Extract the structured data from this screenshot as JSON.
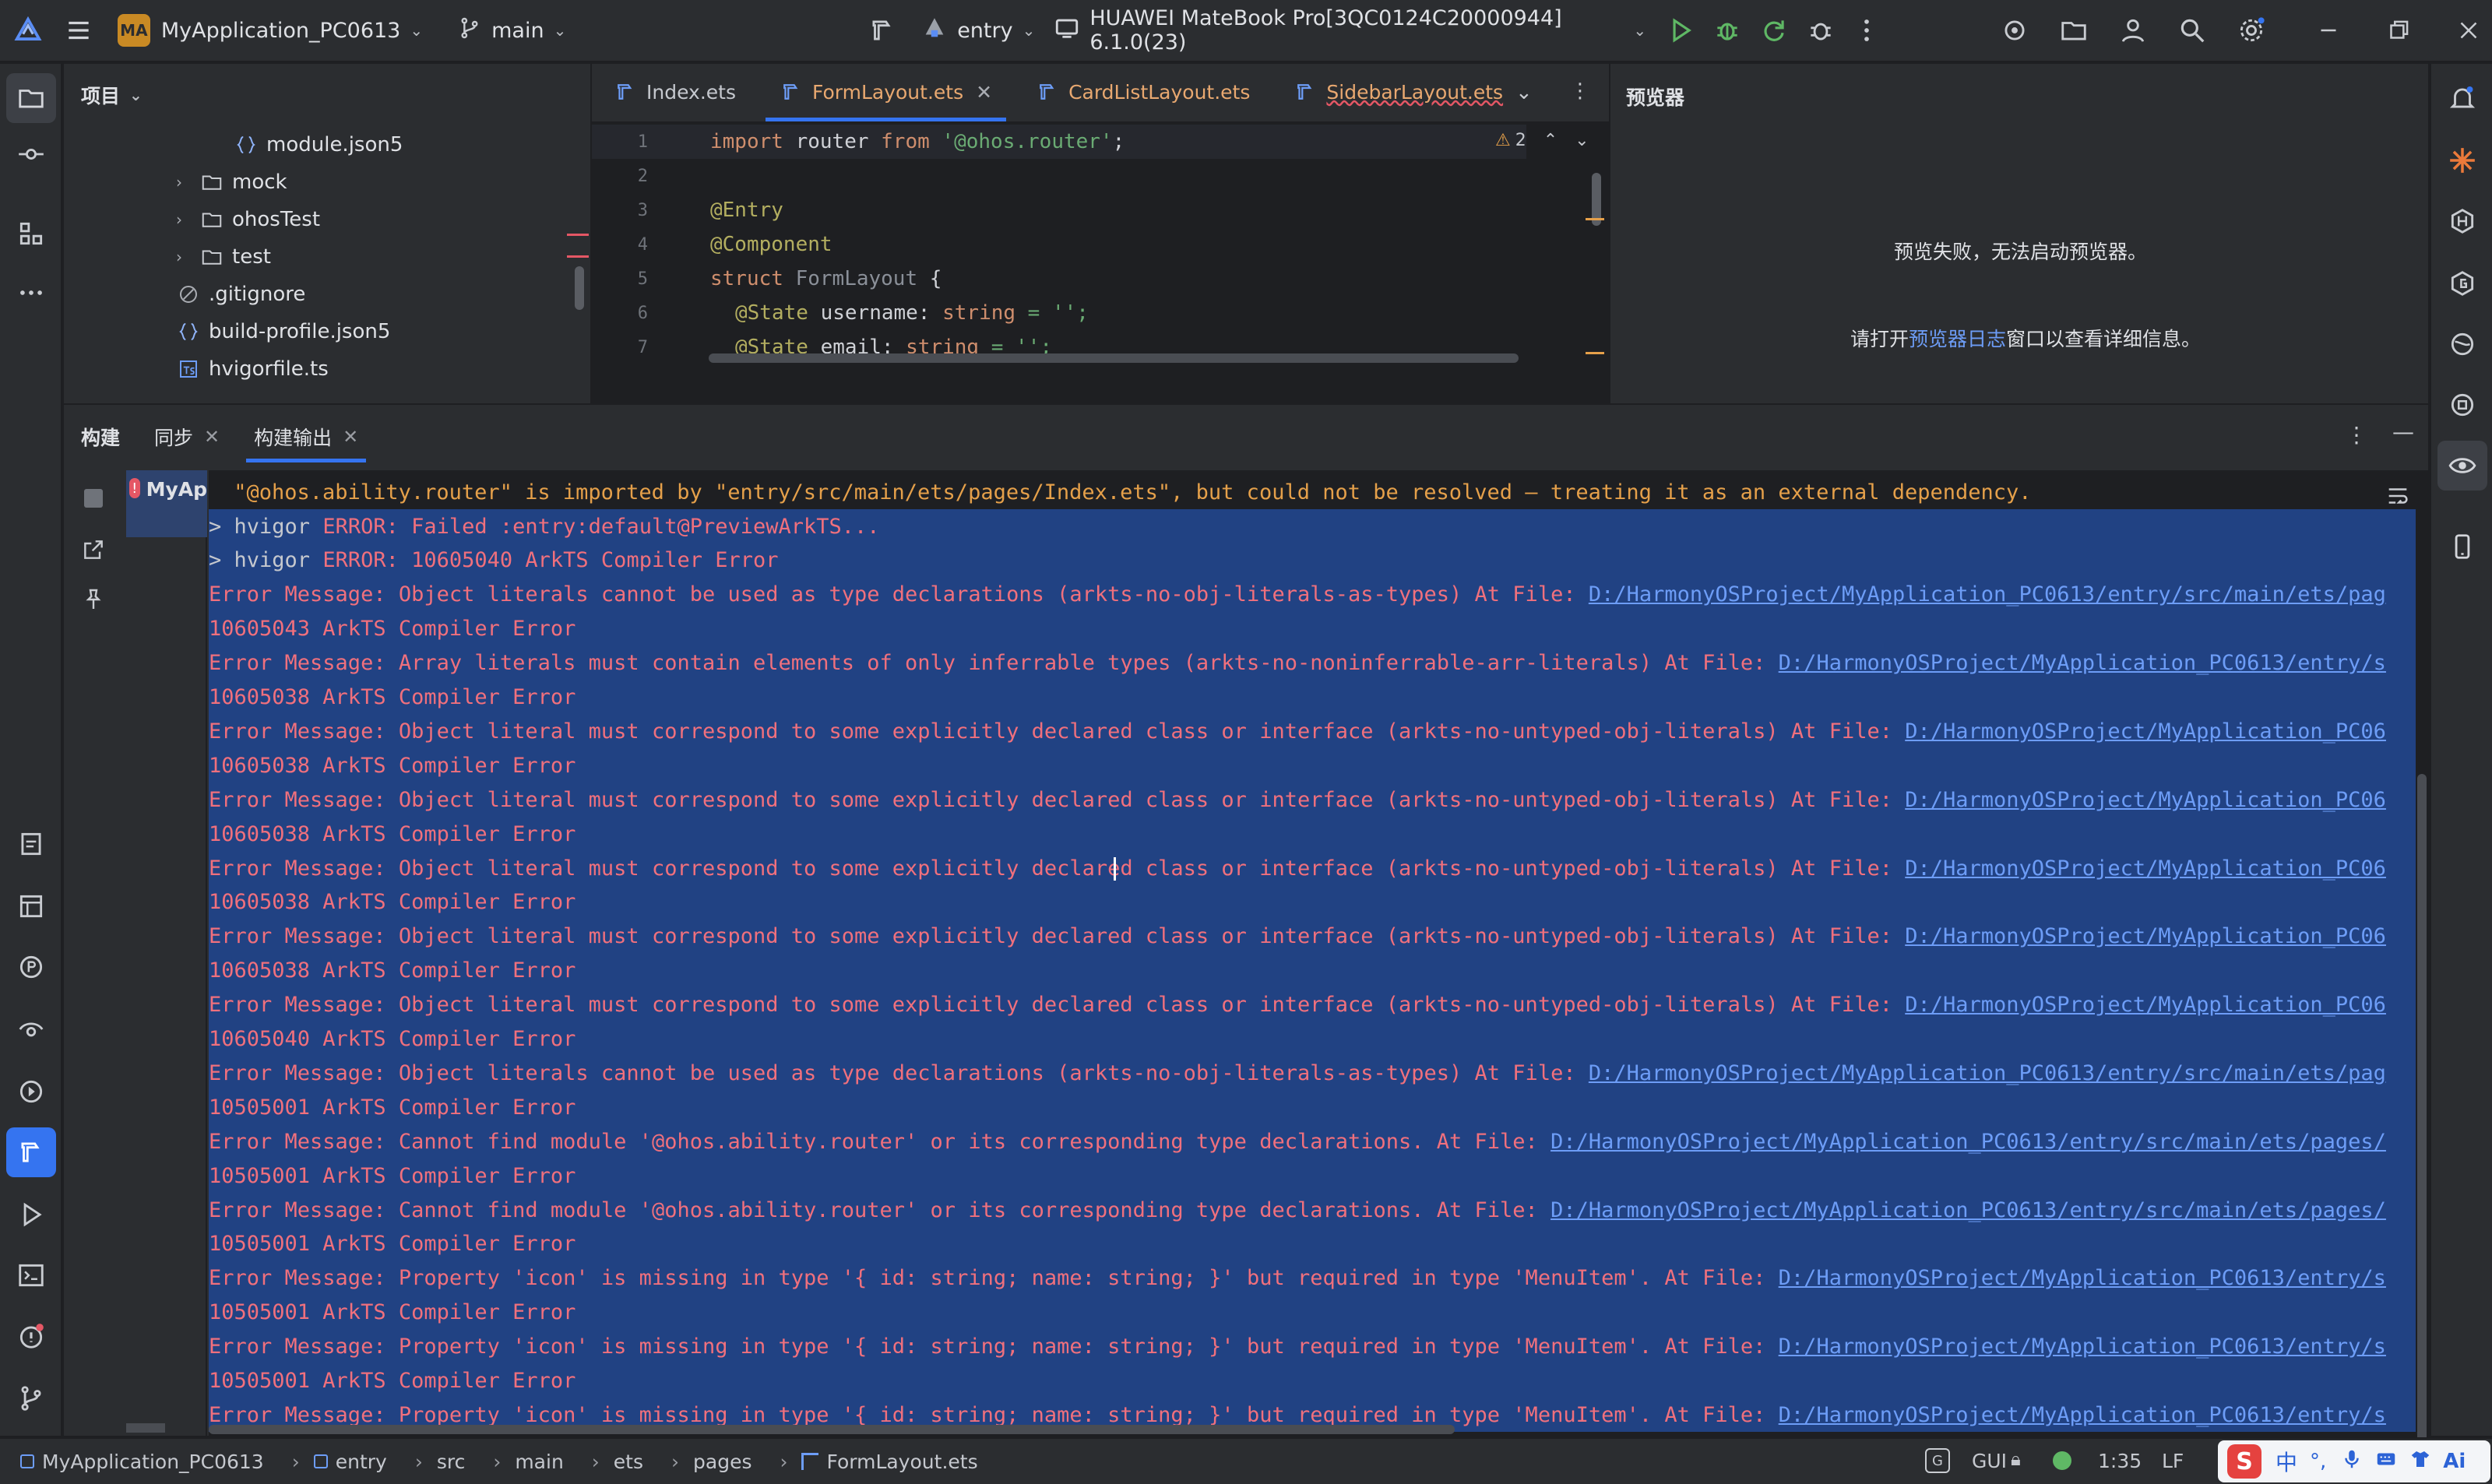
{
  "titlebar": {
    "project_badge": "MA",
    "project_name": "MyApplication_PC0613",
    "branch": "main",
    "module": "entry",
    "device": "HUAWEI MateBook Pro[3QC0124C20000944] 6.1.0(23)"
  },
  "project_panel": {
    "title": "项目",
    "items": [
      {
        "label": "module.json5",
        "icon": "json-icon"
      },
      {
        "label": "mock",
        "icon": "folder-icon"
      },
      {
        "label": "ohosTest",
        "icon": "folder-icon"
      },
      {
        "label": "test",
        "icon": "folder-icon"
      },
      {
        "label": ".gitignore",
        "icon": "ignore-icon"
      },
      {
        "label": "build-profile.json5",
        "icon": "json-icon"
      },
      {
        "label": "hvigorfile.ts",
        "icon": "ts-icon"
      }
    ]
  },
  "editor": {
    "tabs": [
      {
        "label": "Index.ets",
        "active": false
      },
      {
        "label": "FormLayout.ets",
        "active": true
      },
      {
        "label": "CardListLayout.ets",
        "active": false
      },
      {
        "label": "SidebarLayout.ets",
        "active": false
      }
    ],
    "warning_count": "2",
    "lines": [
      {
        "n": "1"
      },
      {
        "n": "2"
      },
      {
        "n": "3"
      },
      {
        "n": "4"
      },
      {
        "n": "5"
      },
      {
        "n": "6"
      },
      {
        "n": "7"
      }
    ],
    "code": {
      "l1_kw1": "import",
      "l1_mid": " router ",
      "l1_kw2": "from",
      "l1_str": " '@ohos.router'",
      "l1_end": ";",
      "l3": "@Entry",
      "l4": "@Component",
      "l5_kw": "struct",
      "l5_name": " FormLayout",
      "l5_end": " {",
      "l6_ann": "@State",
      "l6_mid": " username: ",
      "l6_ty": "string",
      "l6_end": " = '';",
      "l7_ann": "@State",
      "l7_mid": " email: ",
      "l7_ty": "string",
      "l7_end": " = '';"
    }
  },
  "previewer": {
    "title": "预览器",
    "message": "预览失败，无法启动预览器。",
    "hint_prefix": "请打开",
    "hint_link": "预览器日志",
    "hint_suffix": "窗口以查看详细信息。"
  },
  "build_panel": {
    "tabs": [
      {
        "label": "构建",
        "closable": false
      },
      {
        "label": "同步",
        "closable": true
      },
      {
        "label": "构建输出",
        "closable": true
      }
    ],
    "tree_label": "MyAp",
    "warning_line": " \"@ohos.ability.router\" is imported by \"entry/src/main/ets/pages/Index.ets\", but could not be resolved – treating it as an external dependency.",
    "lines": [
      {
        "text": "> hvigor ",
        "err": "ERROR: Failed :entry:default@PreviewArkTS...",
        "link": ""
      },
      {
        "text": "> hvigor ",
        "err": "ERROR: 10605040 ArkTS Compiler Error",
        "link": ""
      },
      {
        "text": "",
        "err": "Error Message: Object literals cannot be used as type declarations (arkts-no-obj-literals-as-types) At File: ",
        "link": "D:/HarmonyOSProject/MyApplication_PC0613/entry/src/main/ets/pag"
      },
      {
        "text": "",
        "err": "10605043 ArkTS Compiler Error",
        "link": ""
      },
      {
        "text": "",
        "err": "Error Message: Array literals must contain elements of only inferrable types (arkts-no-noninferrable-arr-literals) At File: ",
        "link": "D:/HarmonyOSProject/MyApplication_PC0613/entry/s"
      },
      {
        "text": "",
        "err": "10605038 ArkTS Compiler Error",
        "link": ""
      },
      {
        "text": "",
        "err": "Error Message: Object literal must correspond to some explicitly declared class or interface (arkts-no-untyped-obj-literals) At File: ",
        "link": "D:/HarmonyOSProject/MyApplication_PC06"
      },
      {
        "text": "",
        "err": "10605038 ArkTS Compiler Error",
        "link": ""
      },
      {
        "text": "",
        "err": "Error Message: Object literal must correspond to some explicitly declared class or interface (arkts-no-untyped-obj-literals) At File: ",
        "link": "D:/HarmonyOSProject/MyApplication_PC06"
      },
      {
        "text": "",
        "err": "10605038 ArkTS Compiler Error",
        "link": ""
      },
      {
        "text": "",
        "err": "Error Message: Object literal must correspond to some explicitly declared class or interface (arkts-no-untyped-obj-literals) At File: ",
        "link": "D:/HarmonyOSProject/MyApplication_PC06"
      },
      {
        "text": "",
        "err": "10605038 ArkTS Compiler Error",
        "link": ""
      },
      {
        "text": "",
        "err": "Error Message: Object literal must correspond to some explicitly declared class or interface (arkts-no-untyped-obj-literals) At File: ",
        "link": "D:/HarmonyOSProject/MyApplication_PC06"
      },
      {
        "text": "",
        "err": "10605038 ArkTS Compiler Error",
        "link": ""
      },
      {
        "text": "",
        "err": "Error Message: Object literal must correspond to some explicitly declared class or interface (arkts-no-untyped-obj-literals) At File: ",
        "link": "D:/HarmonyOSProject/MyApplication_PC06"
      },
      {
        "text": "",
        "err": "10605040 ArkTS Compiler Error",
        "link": ""
      },
      {
        "text": "",
        "err": "Error Message: Object literals cannot be used as type declarations (arkts-no-obj-literals-as-types) At File: ",
        "link": "D:/HarmonyOSProject/MyApplication_PC0613/entry/src/main/ets/pag"
      },
      {
        "text": "",
        "err": "10505001 ArkTS Compiler Error",
        "link": ""
      },
      {
        "text": "",
        "err": "Error Message: Cannot find module '@ohos.ability.router' or its corresponding type declarations. At File: ",
        "link": "D:/HarmonyOSProject/MyApplication_PC0613/entry/src/main/ets/pages/"
      },
      {
        "text": "",
        "err": "10505001 ArkTS Compiler Error",
        "link": ""
      },
      {
        "text": "",
        "err": "Error Message: Cannot find module '@ohos.ability.router' or its corresponding type declarations. At File: ",
        "link": "D:/HarmonyOSProject/MyApplication_PC0613/entry/src/main/ets/pages/"
      },
      {
        "text": "",
        "err": "10505001 ArkTS Compiler Error",
        "link": ""
      },
      {
        "text": "",
        "err": "Error Message: Property 'icon' is missing in type '{ id: string; name: string; }' but required in type 'MenuItem'. At File: ",
        "link": "D:/HarmonyOSProject/MyApplication_PC0613/entry/s"
      },
      {
        "text": "",
        "err": "10505001 ArkTS Compiler Error",
        "link": ""
      },
      {
        "text": "",
        "err": "Error Message: Property 'icon' is missing in type '{ id: string; name: string; }' but required in type 'MenuItem'. At File: ",
        "link": "D:/HarmonyOSProject/MyApplication_PC0613/entry/s"
      },
      {
        "text": "",
        "err": "10505001 ArkTS Compiler Error",
        "link": ""
      },
      {
        "text": "",
        "err": "Error Message: Property 'icon' is missing in type '{ id: string; name: string; }' but required in type 'MenuItem'. At File: ",
        "link": "D:/HarmonyOSProject/MyApplication_PC0613/entry/s"
      }
    ]
  },
  "statusbar": {
    "breadcrumbs": [
      "MyApplication_PC0613",
      "entry",
      "src",
      "main",
      "ets",
      "pages",
      "FormLayout.ets"
    ],
    "mode": "GUI",
    "position": "1:35",
    "line_ending": "LF",
    "ime": "中"
  },
  "colors": {
    "accent": "#3574f0",
    "error": "#f0707d",
    "link": "#6d9df7",
    "selection": "#214283",
    "warning": "#e5a04a",
    "run_green": "#5fb865"
  }
}
